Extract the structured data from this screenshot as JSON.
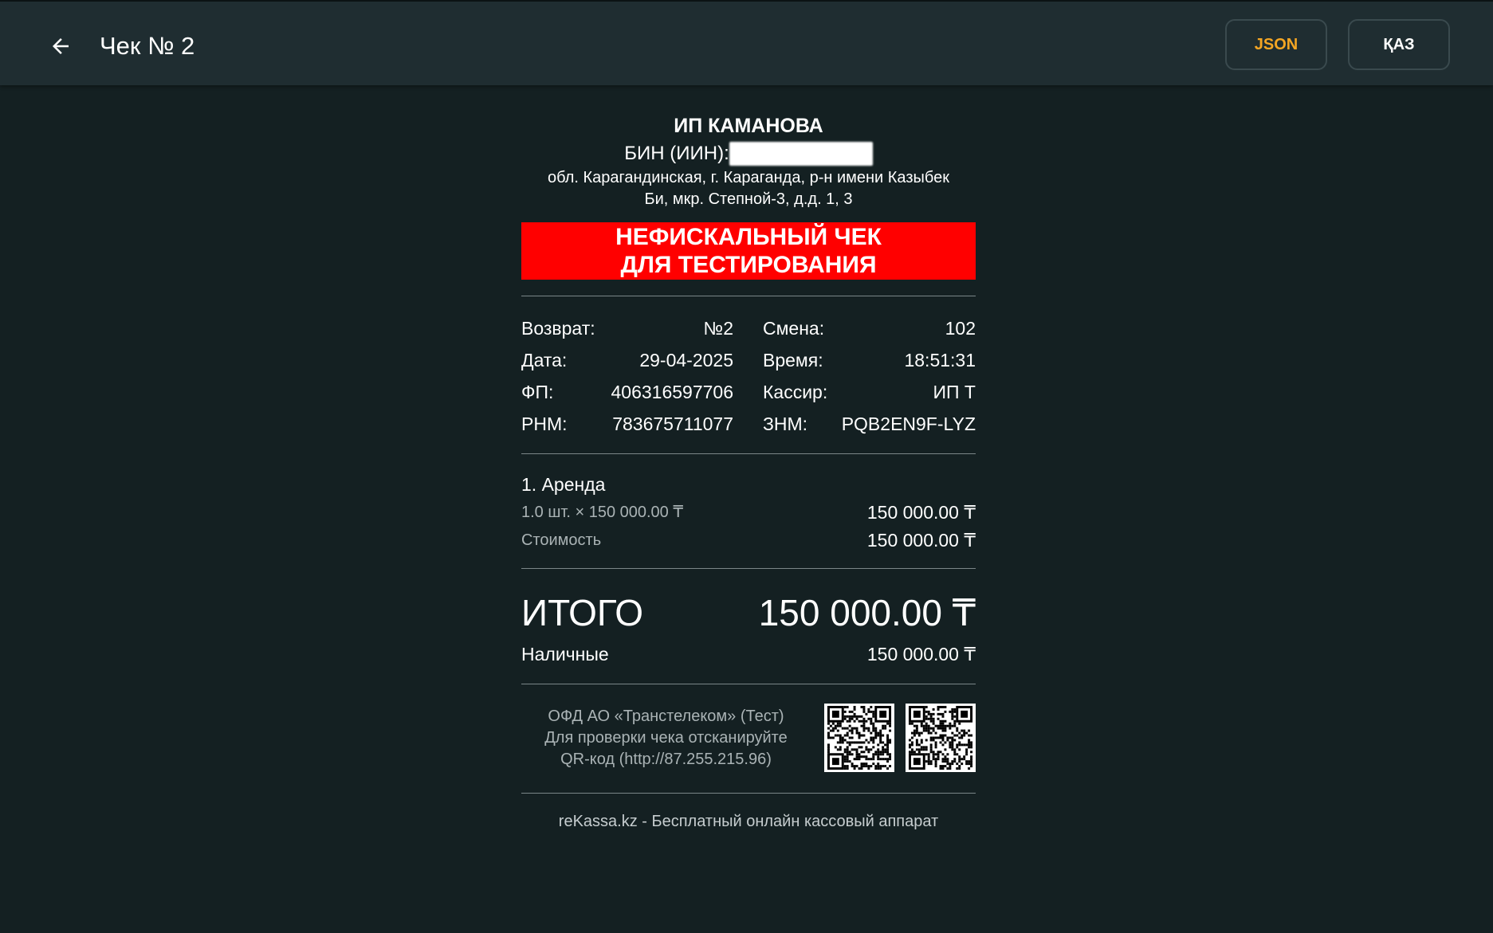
{
  "header": {
    "title": "Чек № 2",
    "json_label": "JSON",
    "kaz_label": "ҚАЗ"
  },
  "receipt": {
    "org_name": "ИП КАМАНОВА",
    "bin_label": "БИН (ИИН):",
    "address_line1": "обл. Карагандинская, г. Караганда, р-н имени Казыбек",
    "address_line2": "Би, мкр. Степной-3, д.д. 1, 3",
    "banner_line1": "НЕФИСКАЛЬНЫЙ ЧЕК",
    "banner_line2": "ДЛЯ ТЕСТИРОВАНИЯ",
    "info_left": [
      {
        "label": "Возврат:",
        "value": "№2"
      },
      {
        "label": "Дата:",
        "value": "29-04-2025"
      },
      {
        "label": "ФП:",
        "value": "406316597706"
      },
      {
        "label": "РНМ:",
        "value": "783675711077"
      }
    ],
    "info_right": [
      {
        "label": "Смена:",
        "value": "102"
      },
      {
        "label": "Время:",
        "value": "18:51:31"
      },
      {
        "label": "Кассир:",
        "value": "ИП Т"
      },
      {
        "label": "ЗНМ:",
        "value": "PQB2EN9F-LYZ"
      }
    ],
    "item": {
      "name": "1. Аренда",
      "qty_price": "1.0 шт. × 150 000.00 ₸",
      "line_total": "150 000.00 ₸",
      "cost_label": "Стоимость",
      "cost_value": "150 000.00 ₸"
    },
    "total_label": "ИТОГО",
    "total_value": "150 000.00 ₸",
    "payment_label": "Наличные",
    "payment_value": "150 000.00 ₸",
    "ofd_line1": "ОФД АО «Транстелеком» (Тест)",
    "ofd_line2": "Для проверки чека отсканируйте",
    "ofd_line3": "QR-код (http://87.255.215.96)",
    "brand_line": "reKassa.kz - Бесплатный онлайн кассовый аппарат"
  }
}
